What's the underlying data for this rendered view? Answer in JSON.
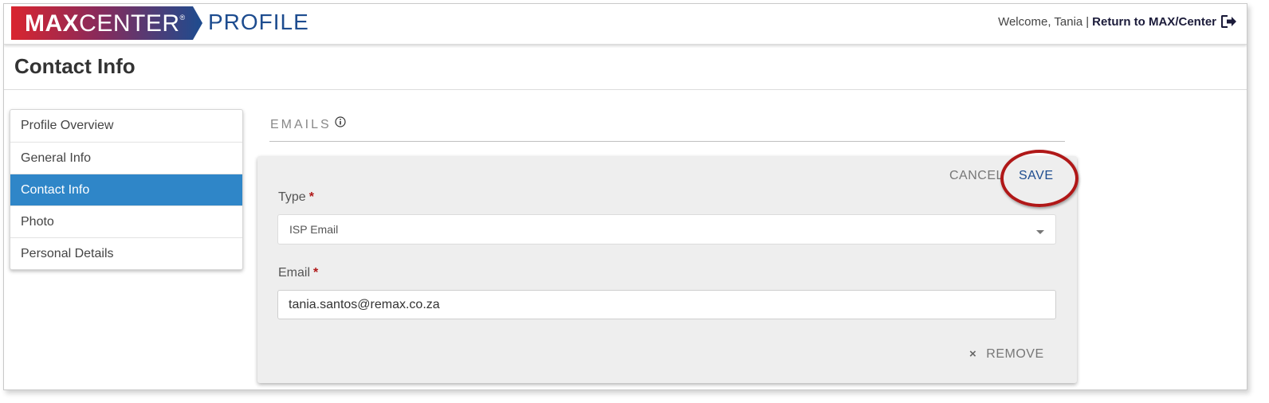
{
  "header": {
    "logo_max": "MAX",
    "logo_center": "CENTER",
    "logo_reg": "®",
    "app_name": "PROFILE",
    "welcome_text": "Welcome, Tania",
    "separator": "|",
    "return_link": "Return to MAX/Center",
    "return_icon": "sign-out-icon",
    "logo_gradient": [
      "#d9252f",
      "#1d4c8f"
    ]
  },
  "page": {
    "title": "Contact Info"
  },
  "sidebar": {
    "items": [
      {
        "label": "Profile Overview",
        "active": false
      },
      {
        "label": "General Info",
        "active": false
      },
      {
        "label": "Contact Info",
        "active": true
      },
      {
        "label": "Photo",
        "active": false
      },
      {
        "label": "Personal Details",
        "active": false
      }
    ],
    "active_color": "#2f86c8"
  },
  "section": {
    "heading": "EMAILS",
    "info_icon": "info-icon"
  },
  "card": {
    "cancel_label": "CANCEL",
    "save_label": "SAVE",
    "type_label": "Type",
    "required_mark": "*",
    "type_value": "ISP Email",
    "email_label": "Email",
    "email_value": "tania.santos@remax.co.za",
    "remove_label": "REMOVE",
    "remove_icon": "x-icon"
  },
  "annotation": {
    "highlight_color": "#b01818"
  }
}
